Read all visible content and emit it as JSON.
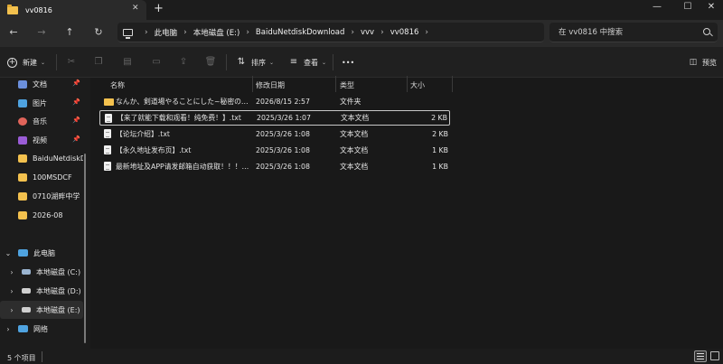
{
  "window": {
    "tab_title": "vv0816",
    "tab_close": "✕",
    "new_tab": "+",
    "minimize": "—",
    "maximize": "☐",
    "close": "✕"
  },
  "nav": {
    "back": "←",
    "forward": "→",
    "up": "↑",
    "refresh": "↻",
    "breadcrumbs": [
      "此电脑",
      "本地磁盘 (E:)",
      "BaiduNetdiskDownload",
      "vvv",
      "vv0816"
    ],
    "sep": "›",
    "search_placeholder": "在 vv0816 中搜索"
  },
  "toolbar": {
    "new_label": "新建",
    "sort_label": "排序",
    "view_label": "查看",
    "more": "•••",
    "preview_label": "预览",
    "caret": "⌄"
  },
  "sidebar": {
    "items": [
      {
        "label": "文档",
        "color": "#6b8fdc"
      },
      {
        "label": "图片",
        "color": "#4fa3e0"
      },
      {
        "label": "音乐",
        "color": "#e0645a"
      },
      {
        "label": "视频",
        "color": "#9a5cd6"
      },
      {
        "label": "BaiduNetdiskDownload",
        "color": "#f3c14e"
      },
      {
        "label": "100MSDCF",
        "color": "#f3c14e"
      },
      {
        "label": "0710湖畔中学",
        "color": "#f3c14e"
      },
      {
        "label": "2026-08",
        "color": "#f3c14e"
      }
    ],
    "pin": "📌",
    "this_pc": "此电脑",
    "drives": [
      "本地磁盘 (C:)",
      "本地磁盘 (D:)",
      "本地磁盘 (E:)"
    ],
    "network": "网络",
    "chev_down": "⌄",
    "chev_right": "›"
  },
  "columns": {
    "name": "名称",
    "modified": "修改日期",
    "type": "类型",
    "size": "大小"
  },
  "files": [
    {
      "name": "なんか、剣道場やることにした~秘密の…",
      "modified": "2026/8/15 2:57",
      "type": "文件夹",
      "size": "",
      "kind": "folder"
    },
    {
      "name": "【来了就能下载和观看！纯免费！】.txt",
      "modified": "2025/3/26 1:07",
      "type": "文本文档",
      "size": "2 KB",
      "kind": "txt"
    },
    {
      "name": "【论坛介绍】.txt",
      "modified": "2025/3/26 1:08",
      "type": "文本文档",
      "size": "2 KB",
      "kind": "txt"
    },
    {
      "name": "【永久地址发布页】.txt",
      "modified": "2025/3/26 1:08",
      "type": "文本文档",
      "size": "1 KB",
      "kind": "txt"
    },
    {
      "name": "最新地址及APP请发邮箱自动获取！！！…",
      "modified": "2025/3/26 1:08",
      "type": "文本文档",
      "size": "1 KB",
      "kind": "txt"
    }
  ],
  "status": {
    "count": "5 个项目"
  }
}
